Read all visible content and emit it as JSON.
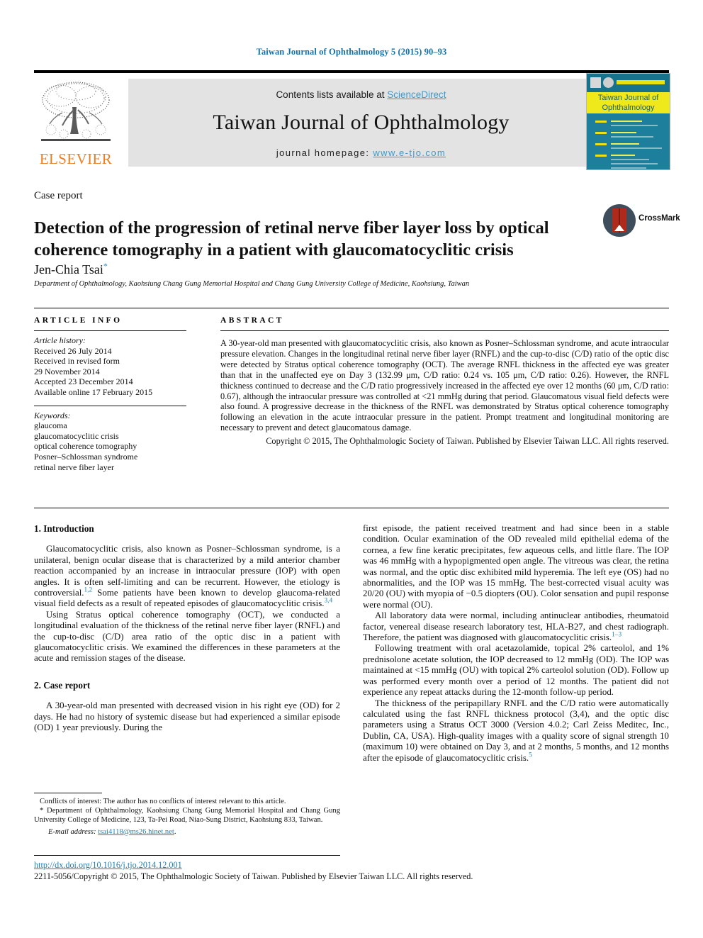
{
  "running_head": "Taiwan Journal of Ophthalmology 5 (2015) 90–93",
  "masthead": {
    "contents_prefix": "Contents lists available at ",
    "sciencedirect": "ScienceDirect",
    "journal_title": "Taiwan Journal of Ophthalmology",
    "homepage_prefix": "journal homepage: ",
    "homepage_url": "www.e-tjo.com",
    "publisher_logo_text": "ELSEVIER",
    "publisher_logo_icon": "elsevier-tree-icon",
    "cover_title_line1": "Taiwan Journal of",
    "cover_title_line2": "Ophthalmology",
    "colors": {
      "link_blue": "#3a9ad0",
      "running_head_blue": "#1271a8",
      "elsevier_orange": "#ec7f22",
      "cover_teal": "#1d7f9b",
      "cover_yellow": "#efe81b"
    }
  },
  "article": {
    "section_type": "Case report",
    "title": "Detection of the progression of retinal nerve fiber layer loss by optical coherence tomography in a patient with glaucomatocyclitic crisis",
    "author": "Jen-Chia Tsai",
    "author_marker": "*",
    "affiliation": "Department of Ophthalmology, Kaohsiung Chang Gung Memorial Hospital and Chang Gung University College of Medicine, Kaohsiung, Taiwan",
    "crossmark_label": "CrossMark"
  },
  "article_info": {
    "heading": "ARTICLE INFO",
    "history_label": "Article history:",
    "history": [
      "Received 26 July 2014",
      "Received in revised form",
      "29 November 2014",
      "Accepted 23 December 2014",
      "Available online 17 February 2015"
    ],
    "keywords_label": "Keywords:",
    "keywords": [
      "glaucoma",
      "glaucomatocyclitic crisis",
      "optical coherence tomography",
      "Posner–Schlossman syndrome",
      "retinal nerve fiber layer"
    ]
  },
  "abstract": {
    "heading": "ABSTRACT",
    "text": "A 30-year-old man presented with glaucomatocyclitic crisis, also known as Posner–Schlossman syndrome, and acute intraocular pressure elevation. Changes in the longitudinal retinal nerve fiber layer (RNFL) and the cup-to-disc (C/D) ratio of the optic disc were detected by Stratus optical coherence tomography (OCT). The average RNFL thickness in the affected eye was greater than that in the unaffected eye on Day 3 (132.99 μm, C/D ratio: 0.24 vs. 105 μm, C/D ratio: 0.26). However, the RNFL thickness continued to decrease and the C/D ratio progressively increased in the affected eye over 12 months (60 μm, C/D ratio: 0.67), although the intraocular pressure was controlled at <21 mmHg during that period. Glaucomatous visual field defects were also found. A progressive decrease in the thickness of the RNFL was demonstrated by Stratus optical coherence tomography following an elevation in the acute intraocular pressure in the patient. Prompt treatment and longitudinal monitoring are necessary to prevent and detect glaucomatous damage.",
    "copyright": "Copyright © 2015, The Ophthalmologic Society of Taiwan. Published by Elsevier Taiwan LLC. All rights reserved."
  },
  "body": {
    "section1_heading": "1. Introduction",
    "intro_p1_a": "Glaucomatocyclitic crisis, also known as Posner–Schlossman syndrome, is a unilateral, benign ocular disease that is characterized by a mild anterior chamber reaction accompanied by an increase in intraocular pressure (IOP) with open angles. It is often self-limiting and can be recurrent. However, the etiology is controversial.",
    "intro_p1_ref1": "1,2",
    "intro_p1_b": " Some patients have been known to develop glaucoma-related visual field defects as a result of repeated episodes of glaucomatocyclitic crisis.",
    "intro_p1_ref2": "3,4",
    "intro_p2": "Using Stratus optical coherence tomography (OCT), we conducted a longitudinal evaluation of the thickness of the retinal nerve fiber layer (RNFL) and the cup-to-disc (C/D) area ratio of the optic disc in a patient with glaucomatocyclitic crisis. We examined the differences in these parameters at the acute and remission stages of the disease.",
    "section2_heading": "2. Case report",
    "case_p1": "A 30-year-old man presented with decreased vision in his right eye (OD) for 2 days. He had no history of systemic disease but had experienced a similar episode (OD) 1 year previously. During the",
    "right_p1": "first episode, the patient received treatment and had since been in a stable condition. Ocular examination of the OD revealed mild epithelial edema of the cornea, a few fine keratic precipitates, few aqueous cells, and little flare. The IOP was 46 mmHg with a hypopigmented open angle. The vitreous was clear, the retina was normal, and the optic disc exhibited mild hyperemia. The left eye (OS) had no abnormalities, and the IOP was 15 mmHg. The best-corrected visual acuity was 20/20 (OU) with myopia of −0.5 diopters (OU). Color sensation and pupil response were normal (OU).",
    "right_p2_a": "All laboratory data were normal, including antinuclear antibodies, rheumatoid factor, venereal disease research laboratory test, HLA-B27, and chest radiograph. Therefore, the patient was diagnosed with glaucomatocyclitic crisis.",
    "right_p2_ref": "1–3",
    "right_p3": "Following treatment with oral acetazolamide, topical 2% carteolol, and 1% prednisolone acetate solution, the IOP decreased to 12 mmHg (OD). The IOP was maintained at <15 mmHg (OU) with topical 2% carteolol solution (OD). Follow up was performed every month over a period of 12 months. The patient did not experience any repeat attacks during the 12-month follow-up period.",
    "right_p4_a": "The thickness of the peripapillary RNFL and the C/D ratio were automatically calculated using the fast RNFL thickness protocol (3,4), and the optic disc parameters using a Stratus OCT 3000 (Version 4.0.2; Carl Zeiss Meditec, Inc., Dublin, CA, USA). High-quality images with a quality score of signal strength 10 (maximum 10) were obtained on Day 3, and at 2 months, 5 months, and 12 months after the episode of glaucomatocyclitic crisis.",
    "right_p4_ref": "5"
  },
  "footnotes": {
    "conflicts": "Conflicts of interest: The author has no conflicts of interest relevant to this article.",
    "corresponding": "Department of Ophthalmology, Kaohsiung Chang Gung Memorial Hospital and Chang Gung University College of Medicine, 123, Ta-Pei Road, Niao-Sung District, Kaohsiung 833, Taiwan.",
    "email_label": "E-mail address:",
    "email": "tsai4118@ms26.hinet.net"
  },
  "footer": {
    "doi": "http://dx.doi.org/10.1016/j.tjo.2014.12.001",
    "copyright": "2211-5056/Copyright © 2015, The Ophthalmologic Society of Taiwan. Published by Elsevier Taiwan LLC. All rights reserved."
  }
}
